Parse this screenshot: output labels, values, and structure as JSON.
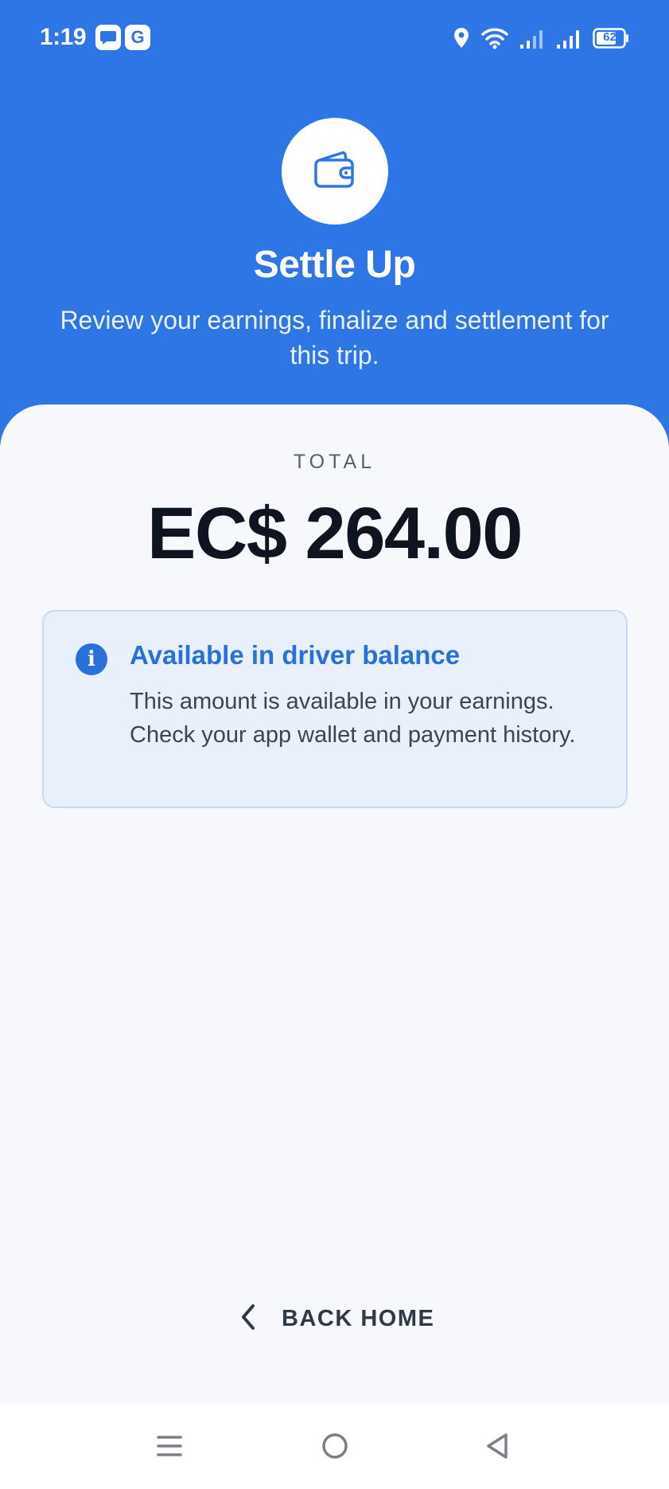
{
  "status_bar": {
    "time": "1:19",
    "app_icons": [
      "message-icon",
      "g-icon"
    ],
    "g_icon_letter": "G",
    "battery": "62"
  },
  "header": {
    "icon": "wallet-icon",
    "title": "Settle Up",
    "subtitle": "Review your earnings, finalize and settlement for this trip."
  },
  "total": {
    "label": "TOTAL",
    "amount": "EC$ 264.00"
  },
  "info_card": {
    "icon": "info-icon",
    "icon_glyph": "i",
    "title": "Available in driver balance",
    "body": "This amount is available in your earnings. Check your app wallet and payment history."
  },
  "back_home": {
    "label": "BACK HOME",
    "icon": "chevron-left-icon"
  },
  "nav_bar": {
    "buttons": [
      "menu-icon",
      "home-icon",
      "back-icon"
    ]
  },
  "colors": {
    "brand_blue": "#2e75e6",
    "info_blue": "#2a70dc",
    "sheet_bg": "#f6f8fc"
  }
}
